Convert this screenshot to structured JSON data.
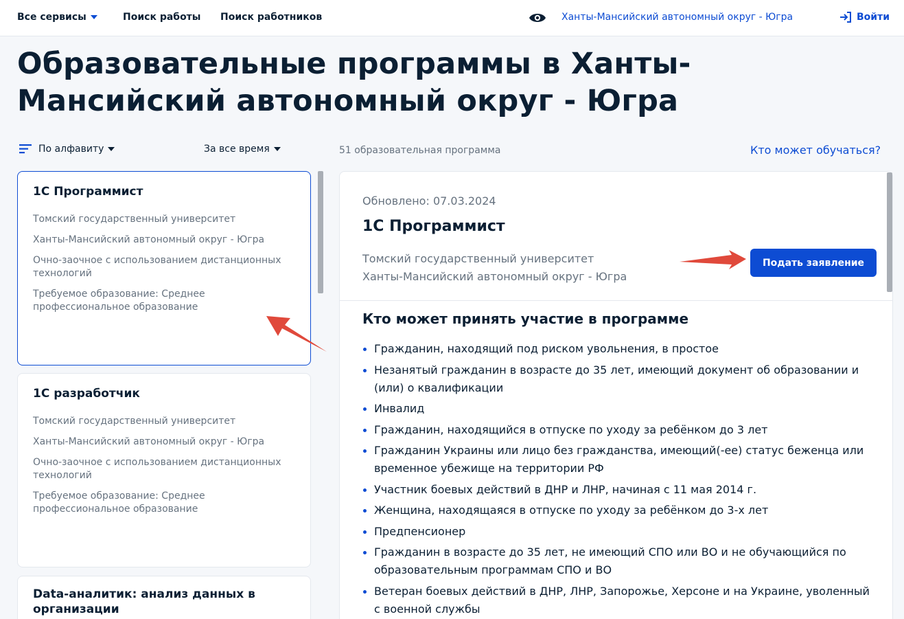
{
  "nav": {
    "services": "Все сервисы",
    "jobs": "Поиск работы",
    "workers": "Поиск работников",
    "region": "Ханты-Мансийский автономный округ - Югра",
    "login": "Войти",
    "accessibility_icon": "eye-icon",
    "login_icon": "login-arrow-icon"
  },
  "page_title": "Образовательные программы в Ханты-Мансийский автономный округ - Югра",
  "filters": {
    "sort": "По алфавиту",
    "sort_icon": "sort-lines-icon",
    "time": "За все время",
    "count": "51 образовательная программа",
    "who_link": "Кто может обучаться?"
  },
  "cards": [
    {
      "title": "1С Программист",
      "university": "Томский государственный университет",
      "region": "Ханты-Мансийский автономный округ - Югра",
      "format": "Очно-заочное с использованием дистанционных технологий",
      "education": "Требуемое образование: Среднее профессиональное образование"
    },
    {
      "title": "1С разработчик",
      "university": "Томский государственный университет",
      "region": "Ханты-Мансийский автономный округ - Югра",
      "format": "Очно-заочное с использованием дистанционных технологий",
      "education": "Требуемое образование: Среднее профессиональное образование"
    },
    {
      "title": "Data-аналитик: анализ данных в организации"
    }
  ],
  "detail": {
    "updated": "Обновлено: 07.03.2024",
    "title": "1С Программист",
    "university": "Томский государственный университет",
    "region": "Ханты-Мансийский автономный округ - Югра",
    "apply_button": "Подать заявление",
    "section_title": "Кто может принять участие в программе",
    "criteria": [
      "Гражданин, находящий под риском увольнения, в простое",
      "Незанятый гражданин в возрасте до 35 лет, имеющий документ об образовании и (или) о квалификации",
      "Инвалид",
      "Гражданин, находящийся в отпуске по уходу за ребёнком до 3 лет",
      "Гражданин Украины или лицо без гражданства, имеющий(-ее) статус беженца или временное убежище на территории РФ",
      "Участник боевых действий в ДНР и ЛНР, начиная с 11 мая 2014 г.",
      "Женщина, находящаяся в отпуске по уходу за ребёнком до 3-х лет",
      "Предпенсионер",
      "Гражданин в возрасте до 35 лет, не имеющий СПО или ВО и не обучающийся по образовательным программам СПО и ВО",
      "Ветеран боевых действий в ДНР, ЛНР, Запорожье, Херсоне и на Украине, уволенный с военной службы"
    ]
  },
  "colors": {
    "accent": "#0d4cd3",
    "text": "#0b1f33",
    "muted": "#66727f",
    "background": "#f5f7fa",
    "annotation": "#e0493b"
  }
}
